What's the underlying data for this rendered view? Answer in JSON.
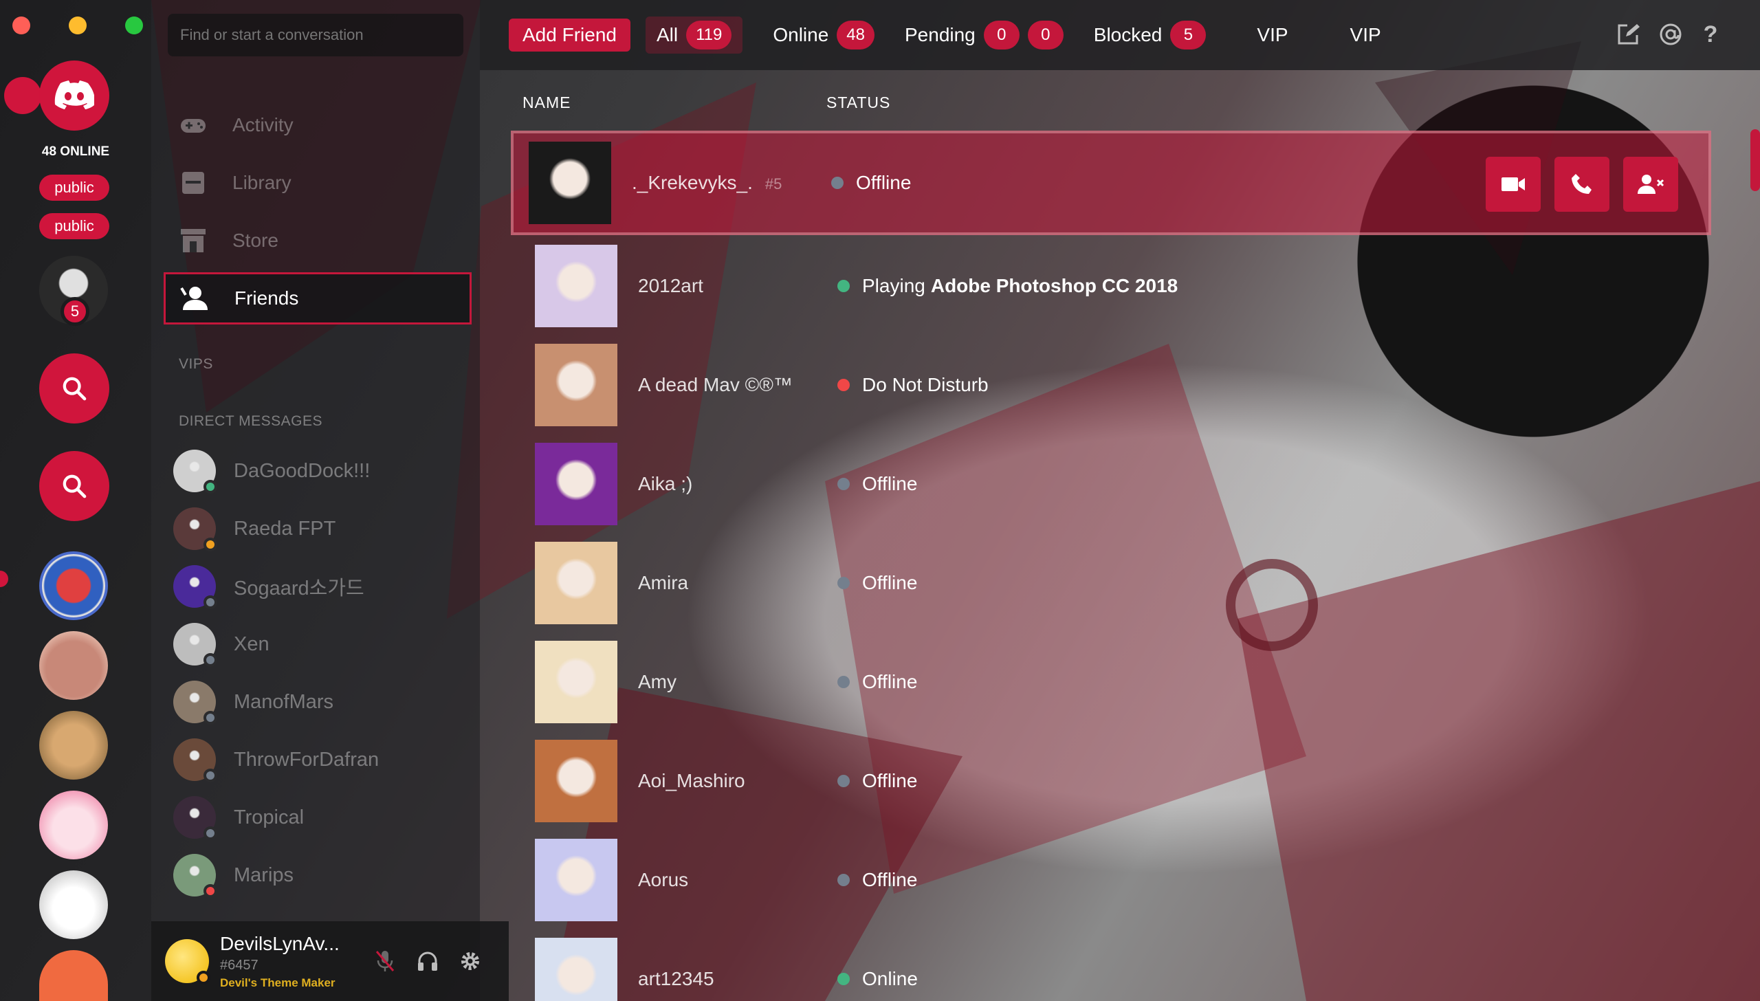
{
  "server_rail": {
    "online_label": "48 ONLINE",
    "tags": [
      "public",
      "public"
    ],
    "server_badge": "5"
  },
  "search": {
    "placeholder": "Find or start a conversation"
  },
  "nav": {
    "activity": "Activity",
    "library": "Library",
    "store": "Store",
    "friends": "Friends"
  },
  "sections": {
    "vips": "VIPS",
    "direct_messages": "DIRECT MESSAGES"
  },
  "dms": [
    {
      "name": "DaGoodDock!!!",
      "status_color": "#43b581",
      "avatar_color": "#cfcfcf"
    },
    {
      "name": "Raeda FPT",
      "status_color": "#f0a020",
      "avatar_color": "#5a3a3a"
    },
    {
      "name": "Sogaard소가드",
      "status_color": "#747f8d",
      "avatar_color": "#4a2a9a"
    },
    {
      "name": "Xen",
      "status_color": "#747f8d",
      "avatar_color": "#bdbdbd"
    },
    {
      "name": "ManofMars",
      "status_color": "#747f8d",
      "avatar_color": "#8a7a6a"
    },
    {
      "name": "ThrowForDafran",
      "status_color": "#747f8d",
      "avatar_color": "#6a4a3a"
    },
    {
      "name": "Tropical",
      "status_color": "#747f8d",
      "avatar_color": "#3a2a3a"
    },
    {
      "name": "Marips",
      "status_color": "#f04747",
      "avatar_color": "#7a9a7a"
    }
  ],
  "user": {
    "name": "DevilsLynAv...",
    "tag": "#6457",
    "activity": "Devil's Theme Maker"
  },
  "topbar": {
    "add_friend": "Add Friend",
    "tabs": [
      {
        "label": "All",
        "badge": "119"
      },
      {
        "label": "Online",
        "badge": "48"
      },
      {
        "label": "Pending",
        "badge": "0",
        "badge2": "0"
      },
      {
        "label": "Blocked",
        "badge": "5"
      },
      {
        "label": "VIP"
      },
      {
        "label": "VIP"
      }
    ]
  },
  "columns": {
    "name": "NAME",
    "status": "STATUS"
  },
  "friends": [
    {
      "name": "._Krekevyks_.",
      "disc": "#5",
      "status": "Offline",
      "status_color": "#747f8d",
      "avatar_color": "#1a1a1a"
    },
    {
      "name": "2012art",
      "status_prefix": "Playing",
      "status": "Adobe Photoshop CC 2018",
      "status_color": "#43b581",
      "avatar_color": "#d8c8e8"
    },
    {
      "name": "A dead Mav ©®™",
      "status": "Do Not Disturb",
      "status_color": "#f04747",
      "avatar_color": "#c89070"
    },
    {
      "name": "Aika ;)",
      "status": "Offline",
      "status_color": "#747f8d",
      "avatar_color": "#7a2a9a"
    },
    {
      "name": "Amira",
      "status": "Offline",
      "status_color": "#747f8d",
      "avatar_color": "#e8c8a0"
    },
    {
      "name": "Amy",
      "status": "Offline",
      "status_color": "#747f8d",
      "avatar_color": "#f0e0c0"
    },
    {
      "name": "Aoi_Mashiro",
      "status": "Offline",
      "status_color": "#747f8d",
      "avatar_color": "#c07040"
    },
    {
      "name": "Aorus",
      "status": "Offline",
      "status_color": "#747f8d",
      "avatar_color": "#c8c8f0"
    },
    {
      "name": "art12345",
      "status": "Online",
      "status_color": "#43b581",
      "avatar_color": "#d8e0f0"
    }
  ],
  "colors": {
    "accent": "#c4173b",
    "accent_bright": "#d0153c"
  }
}
